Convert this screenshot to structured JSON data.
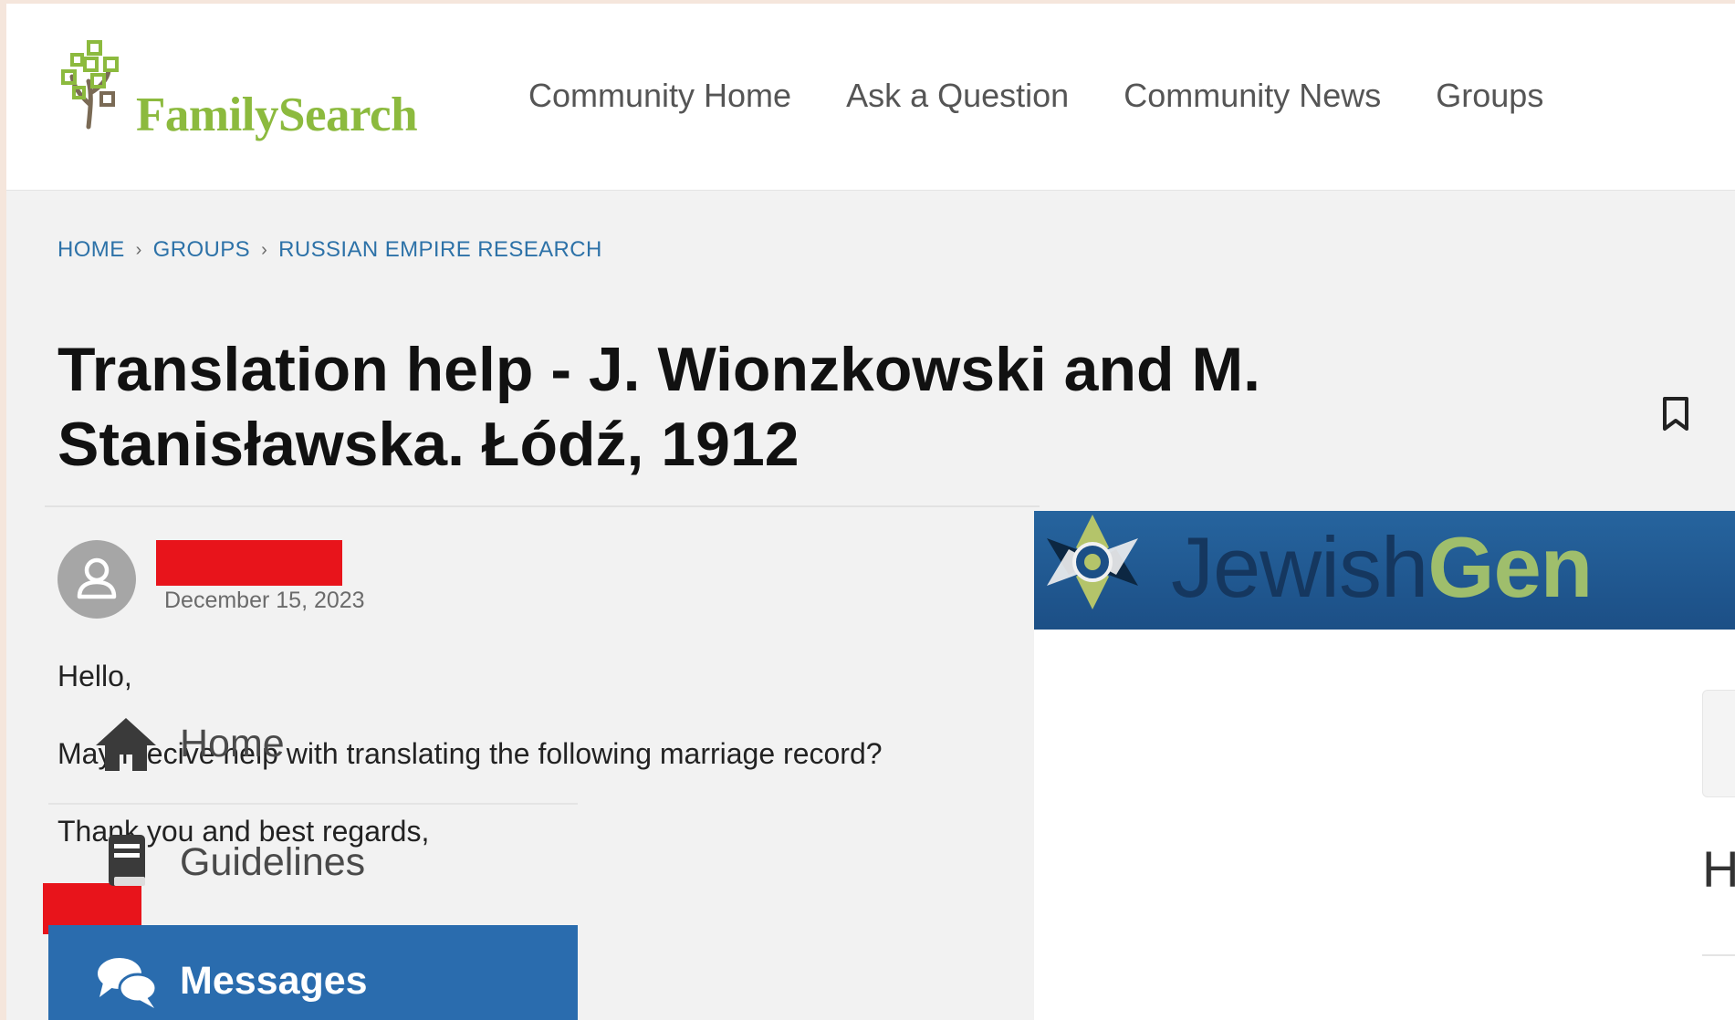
{
  "header": {
    "logo_text": "FamilySearch",
    "nav": [
      "Community Home",
      "Ask a Question",
      "Community News",
      "Groups"
    ]
  },
  "breadcrumb": [
    "HOME",
    "GROUPS",
    "RUSSIAN EMPIRE RESEARCH"
  ],
  "post": {
    "title_line1": "Translation help - J. Wionzkowski and M.",
    "title_line2": "Stanisławska. Łódź, 1912",
    "date": "December 15, 2023",
    "body": [
      "Hello,",
      "May I recive help with translating the following marriage record?",
      "Thank you and best regards,"
    ],
    "footer_dashes": "---"
  },
  "jewishgen": {
    "logo_jewish": "Jewish",
    "logo_gen": "Gen",
    "menu": [
      "Home",
      "Guidelines",
      "Messages"
    ],
    "right_partial_text": "H"
  },
  "colors": {
    "familysearch_green": "#8cba3e",
    "breadcrumb_link": "#2d72a8",
    "redaction": "#e8141b",
    "jewishgen_banner": "#26649e",
    "jewishgen_active": "#2a6cae"
  },
  "icons": [
    "tree-logo-icon",
    "bookmark-icon",
    "user-avatar-icon",
    "jewishgen-emblem-icon",
    "home-icon",
    "book-icon",
    "chat-icon"
  ]
}
